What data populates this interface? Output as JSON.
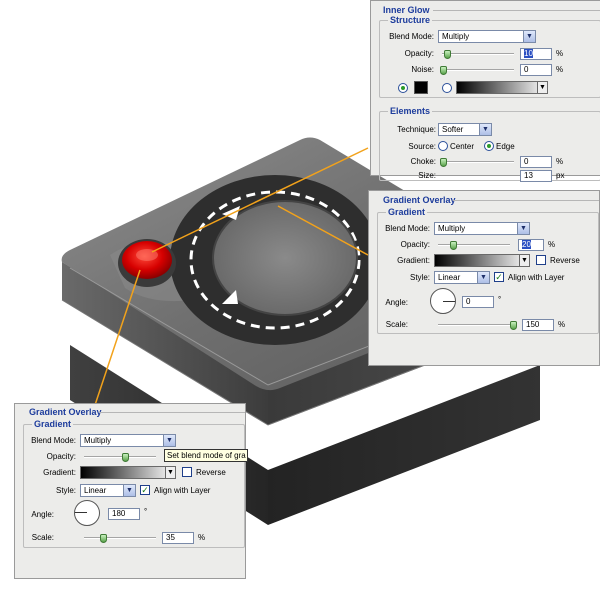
{
  "colors": {
    "panel_bg": "#ececea",
    "title_blue": "#1d3c9c",
    "leader_orange": "#f2a21b",
    "button_red": "#e00000"
  },
  "inner_glow": {
    "title": "Inner Glow",
    "structure": {
      "title": "Structure",
      "blend_mode_label": "Blend Mode:",
      "blend_mode": "Multiply",
      "opacity_label": "Opacity:",
      "opacity": "10",
      "opacity_unit": "%",
      "opacity_fraction": 0.1,
      "noise_label": "Noise:",
      "noise": "0",
      "noise_unit": "%",
      "noise_fraction": 0.0
    },
    "elements": {
      "title": "Elements",
      "technique_label": "Technique:",
      "technique": "Softer",
      "source_label": "Source:",
      "source_center": "Center",
      "source_edge": "Edge",
      "choke_label": "Choke:",
      "choke": "0",
      "choke_unit": "%",
      "choke_fraction": 0.0,
      "size_label": "Size:",
      "size": "13",
      "size_unit": "px"
    }
  },
  "gradient_overlay_right": {
    "title": "Gradient Overlay",
    "gradient": {
      "title": "Gradient",
      "blend_mode_label": "Blend Mode:",
      "blend_mode": "Multiply",
      "opacity_label": "Opacity:",
      "opacity": "20",
      "opacity_unit": "%",
      "opacity_fraction": 0.2,
      "gradient_label": "Gradient:",
      "reverse_label": "Reverse",
      "style_label": "Style:",
      "style": "Linear",
      "align_label": "Align with Layer",
      "angle_label": "Angle:",
      "angle": "0",
      "angle_unit": "°",
      "scale_label": "Scale:",
      "scale": "150",
      "scale_unit": "%",
      "scale_fraction": 1.0
    }
  },
  "gradient_overlay_left": {
    "title": "Gradient Overlay",
    "gradient": {
      "title": "Gradient",
      "blend_mode_label": "Blend Mode:",
      "blend_mode": "Multiply",
      "tooltip": "Set blend mode of gra",
      "opacity_label": "Opacity:",
      "gradient_label": "Gradient:",
      "reverse_label": "Reverse",
      "style_label": "Style:",
      "style": "Linear",
      "align_label": "Align with Layer",
      "angle_label": "Angle:",
      "angle": "180",
      "angle_unit": "°",
      "scale_label": "Scale:",
      "scale": "35",
      "scale_unit": "%",
      "scale_fraction": 0.23
    }
  }
}
